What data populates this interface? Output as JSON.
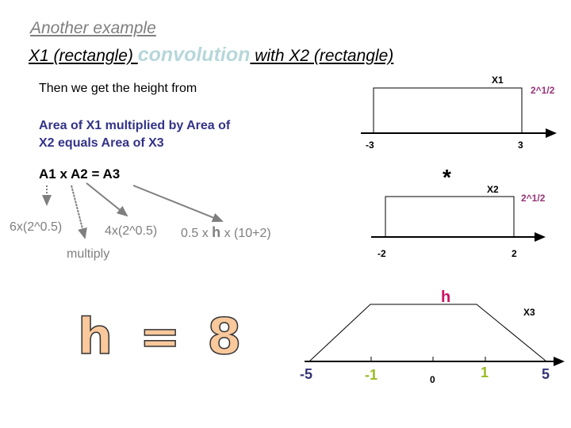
{
  "title": {
    "line1": "Another example",
    "line2_part1": " X1 (rectangle) ",
    "line2_conv": "convolution",
    "line2_part2": " with X2 (rectangle)"
  },
  "text": {
    "height_from": "Then we get the height from",
    "area_line1": "Area of X1 multiplied by Area of",
    "area_line2": "X2 equals Area of X3",
    "equation": "A1 x A2 = A3",
    "a1_value": "6x(2^0.5)",
    "multiply": "multiply",
    "a2_value": "4x(2^0.5)",
    "a3_value_pre": "0.5 x ",
    "a3_value_h": "h",
    "a3_value_post": " x (10+2)",
    "result": "h = 8"
  },
  "x1": {
    "name": "X1",
    "height_label": "2^1/2",
    "left_label": "-3",
    "right_label": "3"
  },
  "convolution_symbol": "*",
  "x2": {
    "name": "X2",
    "height_label": "2^1/2",
    "left_label": "-2",
    "right_label": "2"
  },
  "x3": {
    "name": "X3",
    "height_label": "h",
    "ticks": [
      {
        "label": "-5",
        "color": "#333377"
      },
      {
        "label": "-1",
        "color": "#99bb22"
      },
      {
        "label": "0",
        "color": "#000000"
      },
      {
        "label": "1",
        "color": "#99bb22"
      },
      {
        "label": "5",
        "color": "#333377"
      }
    ]
  },
  "colors": {
    "height_label": "#993377",
    "h_label": "#cc1166",
    "result_fill": "#f9c89b"
  }
}
